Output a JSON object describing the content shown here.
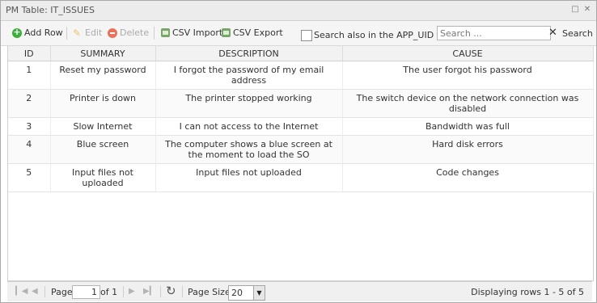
{
  "window": {
    "title": "PM Table: IT_ISSUES"
  },
  "toolbar": {
    "add_label": "Add Row",
    "edit_label": "Edit",
    "delete_label": "Delete",
    "csv_import_label": "CSV Import",
    "csv_export_label": "CSV Export",
    "search_checkbox_label": "Search also in the APP_UID field",
    "search_placeholder": "Search ...",
    "search_value": "",
    "search_button_label": "Search"
  },
  "grid": {
    "columns": [
      "ID",
      "SUMMARY",
      "DESCRIPTION",
      "CAUSE"
    ],
    "rows": [
      [
        "1",
        "Reset my password",
        "I forgot the password of my email address",
        "The user forgot his password"
      ],
      [
        "2",
        "Printer is down",
        "The printer stopped working",
        "The switch device on the network connection was disabled"
      ],
      [
        "3",
        "Slow Internet",
        "I can not access to the Internet",
        "Bandwidth was full"
      ],
      [
        "4",
        "Blue screen",
        "The computer shows a blue screen at the moment to load the SO",
        "Hard disk errors"
      ],
      [
        "5",
        "Input files not uploaded",
        "Input files not uploaded",
        "Code changes"
      ]
    ]
  },
  "pager": {
    "page_label": "Page",
    "page_value": "1",
    "of_label": "of 1",
    "page_size_label": "Page Size:",
    "page_size_value": "20",
    "display_text": "Displaying rows 1 - 5 of 5"
  },
  "icons": {
    "add": "plus-circle-icon",
    "edit": "pencil-icon",
    "delete": "minus-circle-icon",
    "import": "csv-import-icon",
    "export": "csv-export-icon",
    "refresh": "refresh-icon"
  },
  "colors": {
    "add_icon": "#3cae3c",
    "delete_icon": "#e9735a",
    "header_bg": "#f2f2f2"
  }
}
